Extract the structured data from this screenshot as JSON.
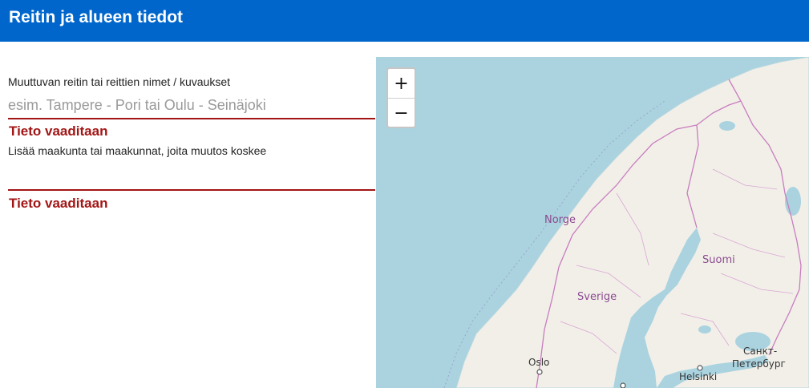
{
  "header": {
    "title": "Reitin ja alueen tiedot"
  },
  "form": {
    "route_names": {
      "label": "Muuttuvan reitin tai reittien nimet / kuvaukset",
      "placeholder": "esim. Tampere - Pori tai Oulu - Seinäjoki",
      "value": "",
      "error": "Tieto vaaditaan"
    },
    "regions": {
      "label": "Lisää maakunta tai maakunnat, joita muutos koskee",
      "value": "",
      "error": "Tieto vaaditaan"
    }
  },
  "map": {
    "zoom_in_label": "+",
    "zoom_out_label": "−",
    "labels": {
      "norway": "Norge",
      "sweden": "Sverige",
      "finland": "Suomi",
      "oslo": "Oslo",
      "helsinki": "Helsinki",
      "stpetersburg_1": "Санкт-",
      "stpetersburg_2": "Петербург"
    },
    "colors": {
      "water": "#aad3df",
      "land": "#f2efe9",
      "border": "#c77dbe",
      "error": "#a31515",
      "header": "#0066cc"
    }
  }
}
